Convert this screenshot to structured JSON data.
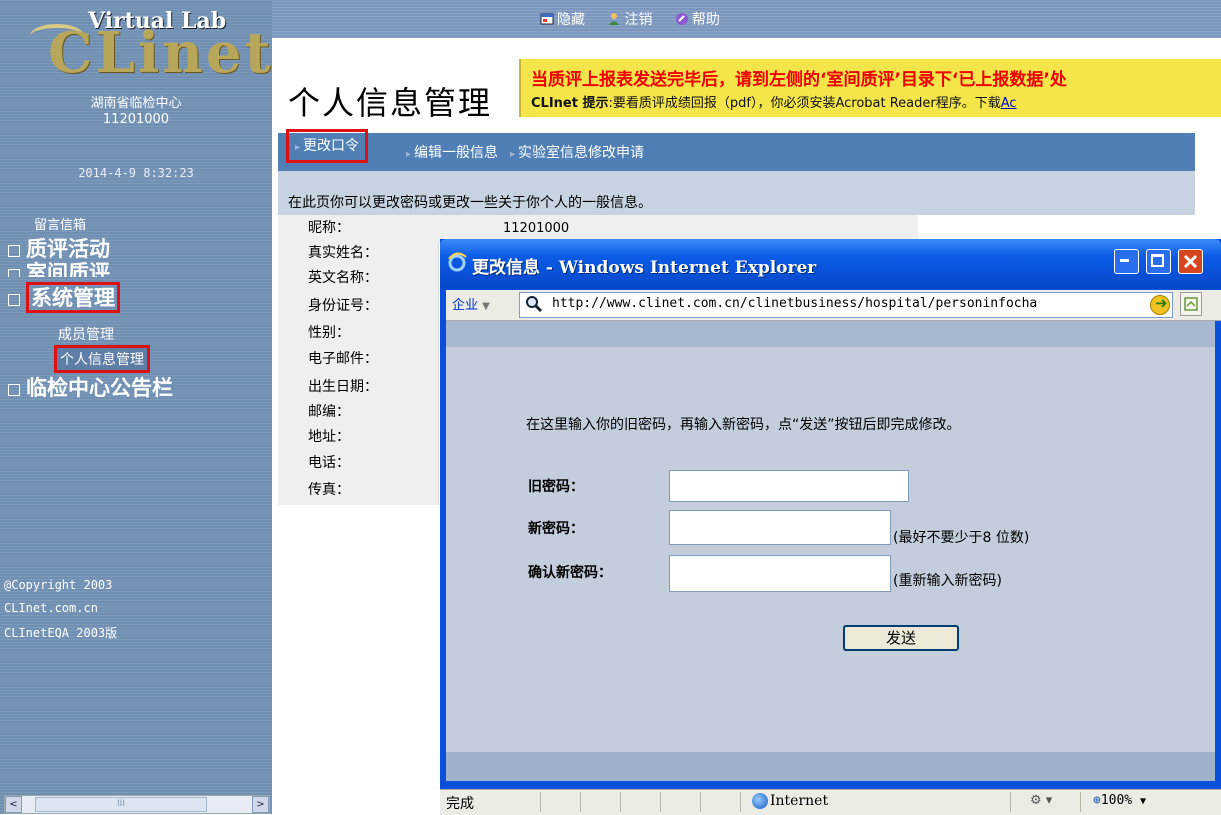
{
  "sidebar": {
    "logo_top": "Virtual Lab",
    "logo_main": "CLinet",
    "org_name": "湖南省临检中心",
    "org_id": "11201000",
    "datetime": "2014-4-9 8:32:23",
    "message_box": "留言信箱",
    "nav": [
      "质评活动",
      "室间质评",
      "系统管理",
      "临检中心公告栏"
    ],
    "sub_items": [
      "成员管理",
      "个人信息管理"
    ],
    "copyright": [
      "@Copyright 2003",
      "CLInet.com.cn",
      "CLInetEQA 2003版"
    ],
    "scroll_left": "<",
    "scroll_right": ">",
    "scroll_grip": "III"
  },
  "topbar": {
    "hide": "隐藏",
    "logout": "注销",
    "help": "帮助"
  },
  "main": {
    "title": "个人信息管理",
    "notice_line1": "当质评上报表发送完毕后，请到左侧的‘室间质评’目录下‘已上报数据’处",
    "notice_line2_brand": "CLInet 提示",
    "notice_line2_text": ":要看质评成绩回报（pdf），你必须安装Acrobat Reader程序。下载",
    "notice_line2_link": "Ac",
    "tabs": [
      "更改口令",
      "编辑一般信息",
      "实验室信息修改申请"
    ],
    "intro": "在此页你可以更改密码或更改一些关于你个人的一般信息。",
    "fields": [
      "昵称：",
      "真实姓名：",
      "英文名称：",
      "身份证号：",
      "性别：",
      "电子邮件：",
      "出生日期：",
      "邮编：",
      "地址：",
      "电话：",
      "传真："
    ],
    "nickname_value": "11201000"
  },
  "popup": {
    "title": "更改信息 - Windows Internet Explorer",
    "company": "企业",
    "url": "http://www.clinet.com.cn/clinetbusiness/hospital/personinfocha",
    "instruction": "在这里输入你的旧密码，再输入新密码，点“发送”按钮后即完成修改。",
    "old_password_label": "旧密码：",
    "new_password_label": "新密码：",
    "confirm_password_label": "确认新密码：",
    "new_password_hint": "(最好不要少于8 位数)",
    "confirm_password_hint": "(重新输入新密码)",
    "send_button": "发送",
    "status": "完成",
    "zone": "Internet",
    "zoom": "100%"
  },
  "colors": {
    "sidebar_bg": "#6f8fb3",
    "tabbar_bg": "#4f7fb4",
    "notice_bg": "#f4e64a",
    "highlight_red": "#dd1111",
    "ie_title_blue": "#0b5be6"
  }
}
